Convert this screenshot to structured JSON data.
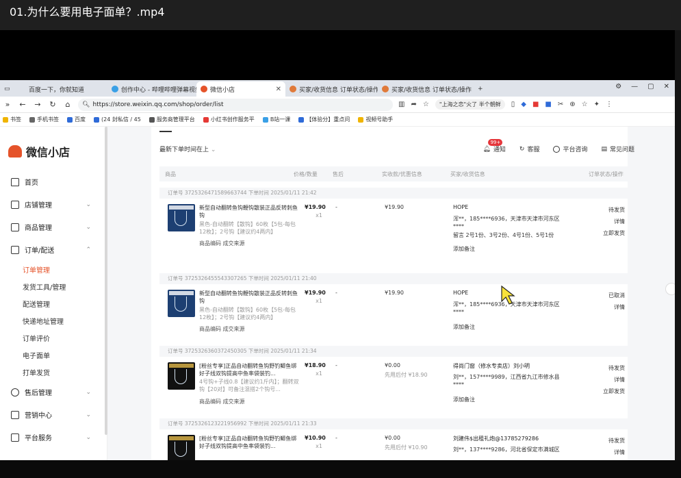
{
  "video": {
    "title": "01.为什么要用电子面单？.mp4"
  },
  "browser": {
    "tabs": [
      {
        "label": "百度一下，你就知道",
        "color": "#2f6bd8"
      },
      {
        "label": "创作中心 - 哔哩哔哩弹幕视频网",
        "color": "#3aa0e6"
      },
      {
        "label": "微信小店",
        "color": "#e5532a",
        "active": true
      },
      {
        "label": "买家/收货信息 订单状态/操作 订",
        "color": "#e07a3a"
      },
      {
        "label": "买家/收货信息 订单状态/操作 订",
        "color": "#e07a3a"
      }
    ],
    "new_tab": "+",
    "url": "https://store.weixin.qq.com/shop/order/list",
    "hot_search": "\"上海之恋\"火了 半个朝鲜",
    "bookmarks": [
      {
        "label": "书签",
        "color": "#f0b400"
      },
      {
        "label": "手机书签",
        "color": "#666666"
      },
      {
        "label": "百度",
        "color": "#2f6bd8"
      },
      {
        "label": "(24 封私信 / 45",
        "color": "#2f6bd8"
      },
      {
        "label": "服务商管理平台",
        "color": "#555555"
      },
      {
        "label": "小红书创作服务平",
        "color": "#e53935"
      },
      {
        "label": "B站一课",
        "color": "#3aa0e6"
      },
      {
        "label": "【体验分】重点问",
        "color": "#2f6bd8"
      },
      {
        "label": "视频号助手",
        "color": "#f0b400"
      }
    ]
  },
  "sidebar": {
    "brand": "微信小店",
    "menu": [
      {
        "label": "首页",
        "icon": "home-icon",
        "chevron": false
      },
      {
        "label": "店铺管理",
        "icon": "store-icon",
        "chevron": true
      },
      {
        "label": "商品管理",
        "icon": "bag-icon",
        "chevron": true
      },
      {
        "label": "订单/配送",
        "icon": "order-icon",
        "chevron": true
      }
    ],
    "submenu": [
      {
        "label": "订单管理",
        "active": true
      },
      {
        "label": "发货工具/管理"
      },
      {
        "label": "配送管理"
      },
      {
        "label": "快递地址管理"
      },
      {
        "label": "订单评价"
      },
      {
        "label": "电子面单"
      },
      {
        "label": "打单发货"
      }
    ],
    "menu2": [
      {
        "label": "售后管理",
        "icon": "headset-icon"
      },
      {
        "label": "营销中心",
        "icon": "marketing-icon"
      },
      {
        "label": "平台服务",
        "icon": "service-icon"
      }
    ]
  },
  "toolbar": {
    "sort": "最新下单时间在上",
    "notice": "通知",
    "notice_badge": "99+",
    "service": "客服",
    "consult": "平台咨询",
    "faq": "常见问题"
  },
  "table_headers": [
    "商品",
    "价格/数量",
    "售后",
    "实收款/优惠信息",
    "买家/收货信息",
    "订单状态/操作"
  ],
  "orders": [
    {
      "head": "订单号 3725326471589663744    下单时间 2025/01/11 21:42",
      "thumb": "blue",
      "title": "新型自动翻转鱼钩鞭钩散装正品反转刺鱼钩",
      "spec": "黑色-自动翻转【散钩】60枚【5包-每包12枚】；2号钩【建议约4两内】",
      "links": "商品编码   成交来源",
      "price": "¥19.90",
      "qty": "x1",
      "after": "-",
      "paid": "¥19.90",
      "paid_sub": "",
      "buyer": "HOPE",
      "address": "浑**，185****6936，天津市天津市河东区****",
      "note": "留言  2号1份、3号2份、4号1份、5号1份",
      "add_note": "添加备注",
      "status": [
        "待发货",
        "详情",
        "立即发货"
      ]
    },
    {
      "head": "订单号 3725326455543307265    下单时间 2025/01/11 21:40",
      "thumb": "blue",
      "title": "新型自动翻转鱼钩鞭钩散装正品反转刺鱼钩",
      "spec": "黑色-自动翻转【散钩】60枚【5包-每包12枚】；2号钩【建议约4两内】",
      "links": "商品编码   成交来源",
      "price": "¥19.90",
      "qty": "x1",
      "after": "-",
      "paid": "¥19.90",
      "paid_sub": "",
      "buyer": "HOPE",
      "address": "浑**，185****6936，天津市天津市河东区****",
      "note": "",
      "add_note": "添加备注",
      "status": [
        "已取消",
        "详情"
      ]
    },
    {
      "head": "订单号 3725326360372450305    下单时间 2025/01/11 21:34",
      "thumb": "dark",
      "title": "[粉丝专享]正品自动翻转鱼钩野钓鲫鱼绑好子线双钩提高中鱼率袋装钓...",
      "spec": "4号钩+子线0.8【建议约1斤内】；翻转双钩【20对】可备注混搭2个钩号...",
      "links": "商品编码   成交来源",
      "price": "¥18.90",
      "qty": "x1",
      "after": "-",
      "paid": "¥0.00",
      "paid_sub": "先用后付  ¥18.90",
      "buyer": "得尚门窗（修水专卖店）刘小明",
      "address": "刘**，157****9989，江西省九江市修水县****",
      "note": "",
      "add_note": "添加备注",
      "status": [
        "待发货",
        "详情",
        "立即发货"
      ]
    },
    {
      "head": "订单号 3725326123221956992    下单时间 2025/01/11 21:33",
      "thumb": "dark",
      "title": "[粉丝专享]正品自动翻转鱼钩野钓鲫鱼绑好子线双钩提高中鱼率袋装钓...",
      "spec": "",
      "links": "",
      "price": "¥10.90",
      "qty": "x1",
      "after": "-",
      "paid": "¥0.00",
      "paid_sub": "先用后付  ¥10.90",
      "buyer": "刘建伟$出租礼炮@13785279286",
      "address": "刘**，137****9286，河北省保定市满城区",
      "note": "",
      "add_note": "",
      "status": [
        "待发货",
        "详情"
      ]
    }
  ],
  "colors": {
    "accent": "#e5532a",
    "badge": "#e5353a"
  }
}
